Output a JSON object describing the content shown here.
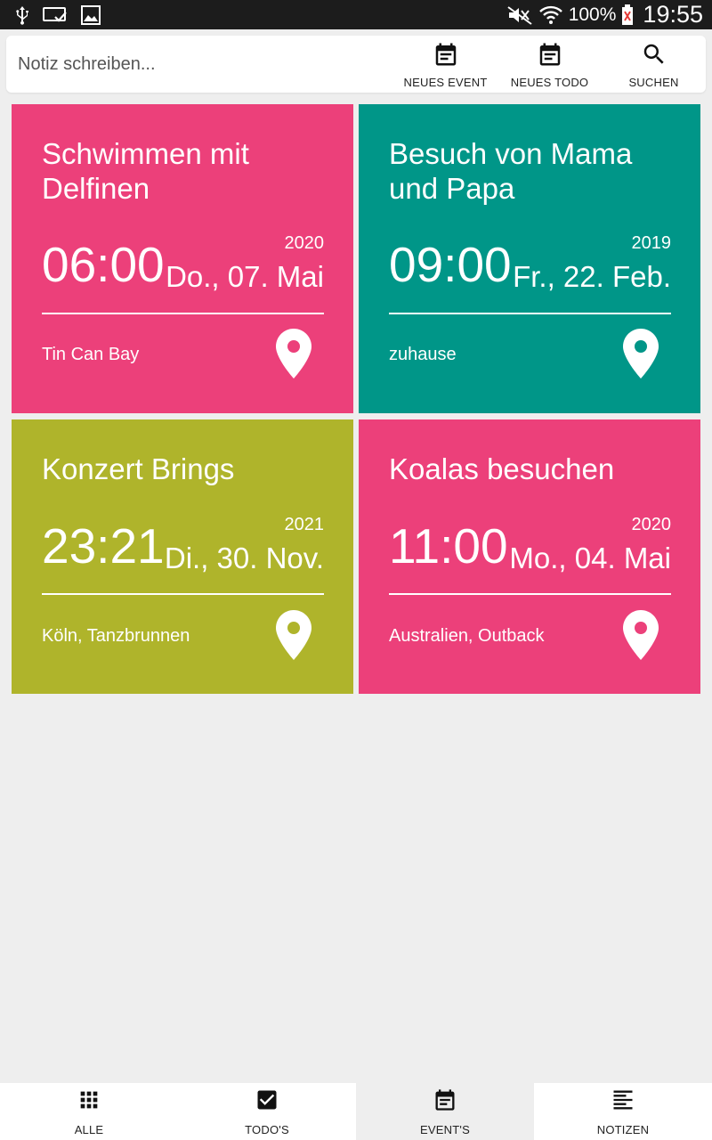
{
  "status_bar": {
    "battery_percent": "100%",
    "time": "19:55",
    "icons": [
      "usb-icon",
      "cast-icon",
      "image-icon",
      "mute-icon",
      "wifi-icon",
      "battery-icon"
    ]
  },
  "toolbar": {
    "note_placeholder": "Notiz schreiben...",
    "new_event_label": "NEUES EVENT",
    "new_todo_label": "NEUES TODO",
    "search_label": "SUCHEN"
  },
  "cards": [
    {
      "title": "Schwimmen mit Delfinen",
      "year": "2020",
      "time": "06:00",
      "date": "Do., 07. Mai",
      "location": "Tin Can Bay",
      "color": "#ec407a"
    },
    {
      "title": "Besuch von Mama und Papa",
      "year": "2019",
      "time": "09:00",
      "date": "Fr., 22. Feb.",
      "location": "zuhause",
      "color": "#009688"
    },
    {
      "title": "Konzert Brings",
      "year": "2021",
      "time": "23:21",
      "date": "Di., 30. Nov.",
      "location": "Köln, Tanzbrunnen",
      "color": "#afb42b"
    },
    {
      "title": "Koalas besuchen",
      "year": "2020",
      "time": "11:00",
      "date": "Mo., 04. Mai",
      "location": "Australien, Outback",
      "color": "#ec407a"
    }
  ],
  "bottom_nav": {
    "items": [
      {
        "label": "ALLE",
        "icon": "grid-icon"
      },
      {
        "label": "TODO'S",
        "icon": "checkbox-icon"
      },
      {
        "label": "EVENT'S",
        "icon": "calendar-icon"
      },
      {
        "label": "NOTIZEN",
        "icon": "notes-icon"
      }
    ],
    "active": "EVENT'S"
  },
  "colors": {
    "background": "#eeeeee",
    "pink": "#ec407a",
    "teal": "#009688",
    "olive": "#afb42b"
  }
}
